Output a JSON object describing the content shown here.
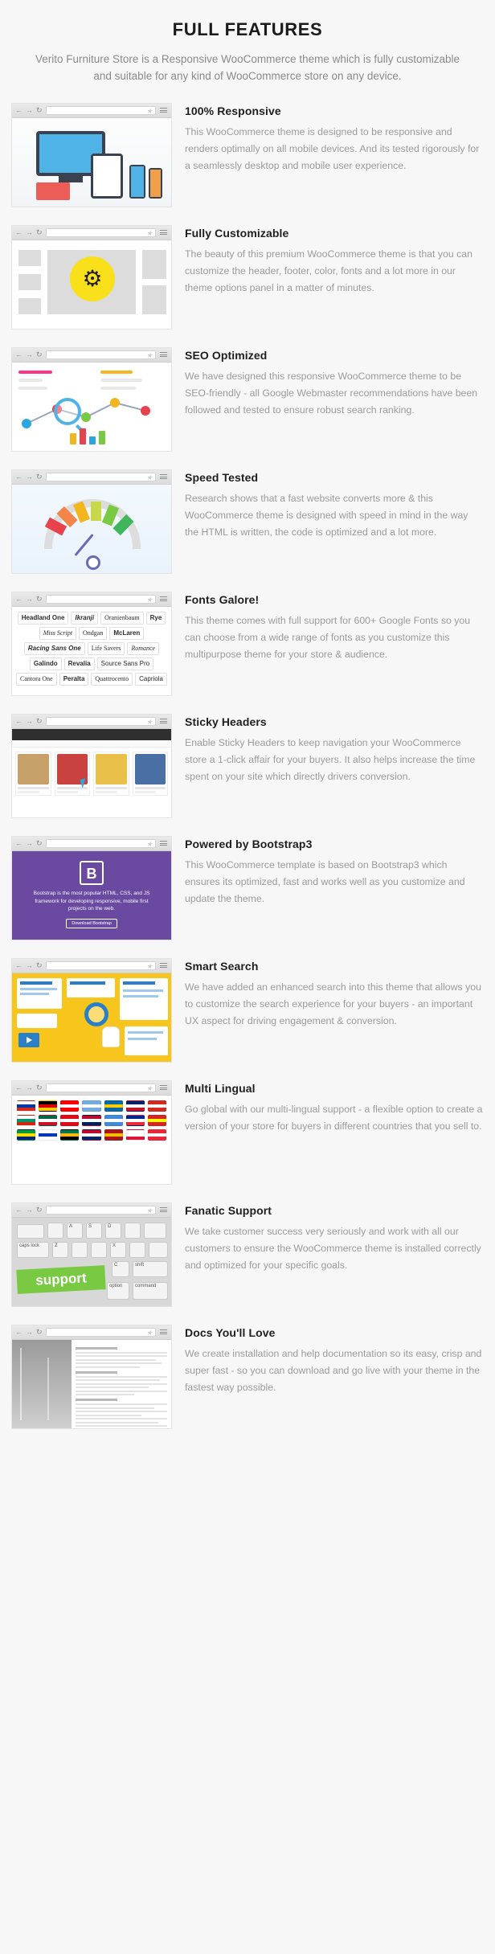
{
  "header": {
    "title": "FULL FEATURES",
    "subtitle": "Verito Furniture Store is a Responsive WooCommerce theme which is fully customizable and suitable for any kind of WooCommerce store on any device."
  },
  "browser_chrome": {
    "back_icon": "back-arrow-icon",
    "forward_icon": "forward-arrow-icon",
    "reload_icon": "reload-icon",
    "back_glyph": "←",
    "forward_glyph": "→",
    "reload_glyph": "↻",
    "star_glyph": "★",
    "url_value": "",
    "url_placeholder": ""
  },
  "features": [
    {
      "title": "100% Responsive",
      "body": "This WooCommerce theme is designed to be responsive and renders optimally on all mobile devices. And its tested rigorously for a seamlessly desktop and mobile user experience.",
      "image_name": "responsive-devices-illustration"
    },
    {
      "title": "Fully Customizable",
      "body": "The beauty of this premium WooCommerce theme is that you can customize the header, footer, color, fonts and a lot more in our theme options panel in a matter of minutes.",
      "image_name": "customization-gear-illustration"
    },
    {
      "title": "SEO Optimized",
      "body": "We have designed this responsive WooCommerce theme to be SEO-friendly - all Google Webmaster recommendations have been followed and tested to ensure robust search ranking.",
      "image_name": "seo-analytics-illustration"
    },
    {
      "title": "Speed Tested",
      "body": "Research shows that a fast website converts more & this WooCommerce theme is designed with speed in mind in the way the HTML is written, the code is optimized and a lot more.",
      "image_name": "speed-gauge-illustration"
    },
    {
      "title": "Fonts Galore!",
      "body": "This theme comes with full support for 600+ Google Fonts so you can choose from a wide range of fonts as you customize this multipurpose theme for your store & audience.",
      "image_name": "google-fonts-samples-illustration"
    },
    {
      "title": "Sticky Headers",
      "body": "Enable Sticky Headers to keep navigation your WooCommerce store a 1-click affair for your buyers. It also helps increase the time spent on your site which directly drivers conversion.",
      "image_name": "sticky-header-shop-screenshot"
    },
    {
      "title": "Powered by Bootstrap3",
      "body": "This WooCommerce template is based on Bootstrap3 which ensures its optimized, fast and works well as you customize and update the theme.",
      "image_name": "bootstrap-homepage-screenshot"
    },
    {
      "title": "Smart Search",
      "body": "We have added an enhanced search into this theme that allows you to customize the search experience for your buyers - an important UX aspect for driving engagement & conversion.",
      "image_name": "smart-search-illustration"
    },
    {
      "title": "Multi Lingual",
      "body": "Go global with our multi-lingual support - a flexible option to create a version of your store for buyers in different countries that you sell to.",
      "image_name": "country-flags-grid-illustration"
    },
    {
      "title": "Fanatic Support",
      "body": "We take customer success very seriously and work with all our customers to ensure the WooCommerce theme is installed correctly and optimized for your specific goals.",
      "image_name": "support-keyboard-photo"
    },
    {
      "title": "Docs You'll Love",
      "body": "We create installation and help documentation so its easy, crisp and super fast - so you can download and go live with your theme in the fastest way possible.",
      "image_name": "documentation-page-screenshot"
    }
  ],
  "font_samples": [
    {
      "name": "Headland One",
      "style": "f-b"
    },
    {
      "name": "Ikranji",
      "style": "f-bi"
    },
    {
      "name": "Oranienbaum",
      "style": "f-s"
    },
    {
      "name": "Rye",
      "style": "f-b"
    },
    {
      "name": "Miss Script",
      "style": "f-i"
    },
    {
      "name": "Ondgan",
      "style": "f-s"
    },
    {
      "name": "McLaren",
      "style": "f-b"
    },
    {
      "name": "Racing Sans One",
      "style": "f-bi"
    },
    {
      "name": "Life Savers",
      "style": "f-s"
    },
    {
      "name": "Romance",
      "style": "f-i"
    },
    {
      "name": "Galindo",
      "style": "f-b"
    },
    {
      "name": "Revalia",
      "style": "f-b"
    },
    {
      "name": "Source Sans Pro",
      "style": ""
    },
    {
      "name": "Cantora One",
      "style": "f-s"
    },
    {
      "name": "Peralta",
      "style": "f-b"
    },
    {
      "name": "Quattrocento",
      "style": "f-s"
    },
    {
      "name": "Capriola",
      "style": ""
    }
  ],
  "bootstrap_panel": {
    "logo_letter": "B",
    "tagline": "Bootstrap is the most popular HTML, CSS, and JS framework for developing responsive, mobile first projects on the web.",
    "button_label": "Download Bootstrap"
  },
  "keyboard_keys": {
    "caps_lock": "caps lock",
    "key_a": "A",
    "key_s": "S",
    "key_d": "D",
    "key_z": "Z",
    "key_x": "X",
    "key_c": "C",
    "key_shift": "shift",
    "key_command": "command",
    "key_option": "option",
    "overlay_text": "support"
  },
  "flags": [
    {
      "country": "Russia",
      "colors": [
        "#ffffff",
        "#0039a6",
        "#d52b1e"
      ]
    },
    {
      "country": "Germany",
      "colors": [
        "#000000",
        "#dd0000",
        "#ffce00"
      ]
    },
    {
      "country": "Canada",
      "colors": [
        "#ff0000",
        "#ffffff",
        "#ff0000"
      ]
    },
    {
      "country": "Argentina",
      "colors": [
        "#74acdf",
        "#ffffff",
        "#74acdf"
      ]
    },
    {
      "country": "Sweden",
      "colors": [
        "#006aa7",
        "#fecc00",
        "#006aa7"
      ]
    },
    {
      "country": "United Kingdom",
      "colors": [
        "#012169",
        "#ffffff",
        "#c8102e"
      ]
    },
    {
      "country": "Switzerland",
      "colors": [
        "#d52b1e",
        "#ffffff",
        "#d52b1e"
      ]
    },
    {
      "country": "Bulgaria",
      "colors": [
        "#ffffff",
        "#00966e",
        "#d62612"
      ]
    },
    {
      "country": "Mexico",
      "colors": [
        "#006847",
        "#ffffff",
        "#ce1126"
      ]
    },
    {
      "country": "Turkey",
      "colors": [
        "#e30a17",
        "#ffffff",
        "#e30a17"
      ]
    },
    {
      "country": "Norway",
      "colors": [
        "#ba0c2f",
        "#ffffff",
        "#00205b"
      ]
    },
    {
      "country": "Somalia",
      "colors": [
        "#4189dd",
        "#ffffff",
        "#4189dd"
      ]
    },
    {
      "country": "France",
      "colors": [
        "#002395",
        "#ffffff",
        "#ed2939"
      ]
    },
    {
      "country": "Vietnam",
      "colors": [
        "#da251d",
        "#ffff00",
        "#da251d"
      ]
    },
    {
      "country": "Brazil",
      "colors": [
        "#009c3b",
        "#ffdf00",
        "#002776"
      ]
    },
    {
      "country": "Israel",
      "colors": [
        "#ffffff",
        "#0038b8",
        "#ffffff"
      ]
    },
    {
      "country": "South Africa",
      "colors": [
        "#007a4d",
        "#ffb612",
        "#000000"
      ]
    },
    {
      "country": "Liberia",
      "colors": [
        "#bf0a30",
        "#ffffff",
        "#002868"
      ]
    },
    {
      "country": "Spain",
      "colors": [
        "#aa151b",
        "#f1bf00",
        "#aa151b"
      ]
    },
    {
      "country": "Poland",
      "colors": [
        "#ffffff",
        "#ffffff",
        "#dc143c"
      ]
    },
    {
      "country": "Austria",
      "colors": [
        "#ed2939",
        "#ffffff",
        "#ed2939"
      ]
    }
  ],
  "colors": {
    "page_bg": "#f7f7f7",
    "heading": "#1f1f1f",
    "body_text": "#9b9b9b",
    "accent_yellow": "#f9e01b",
    "accent_blue": "#4fb3e8",
    "bootstrap_purple": "#6a4aa0",
    "search_yellow": "#f8c51c",
    "support_green": "#7ac943"
  }
}
